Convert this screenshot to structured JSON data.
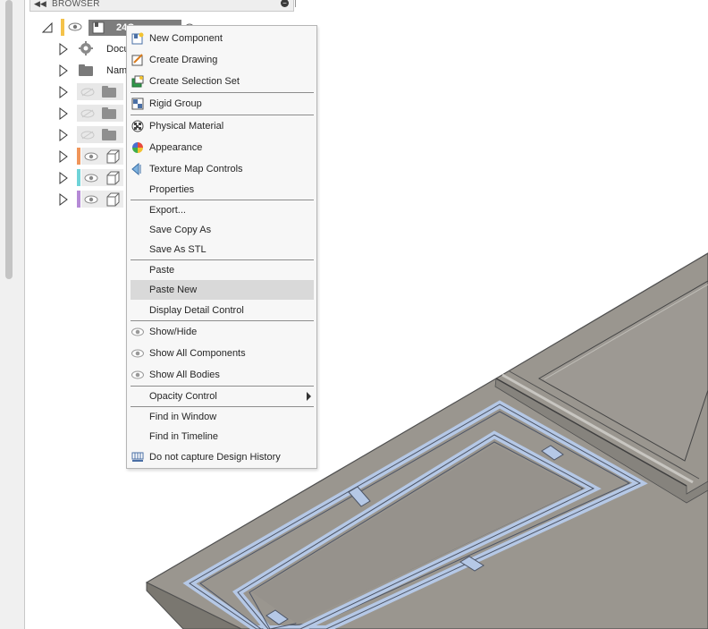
{
  "browser": {
    "title": "BROWSER",
    "collapse_icon": "double-left-arrow-icon",
    "component_label": "24C...",
    "rows": [
      {
        "label": "Docu"
      },
      {
        "label": "Nam"
      }
    ]
  },
  "context_menu": {
    "items": [
      {
        "label": "New Component",
        "icon": "new-component-icon"
      },
      {
        "label": "Create Drawing",
        "icon": "create-drawing-icon"
      },
      {
        "label": "Create Selection Set",
        "icon": "selection-set-icon"
      },
      {
        "label": "Rigid Group",
        "icon": "rigid-group-icon"
      },
      {
        "label": "Physical Material",
        "icon": "physical-material-icon"
      },
      {
        "label": "Appearance",
        "icon": "appearance-icon"
      },
      {
        "label": "Texture Map Controls",
        "icon": "texture-map-icon"
      },
      {
        "label": "Properties"
      },
      {
        "label": "Export..."
      },
      {
        "label": "Save Copy As"
      },
      {
        "label": "Save As STL"
      },
      {
        "label": "Paste"
      },
      {
        "label": "Paste New"
      },
      {
        "label": "Display Detail Control"
      },
      {
        "label": "Show/Hide",
        "icon": "eye-icon"
      },
      {
        "label": "Show All Components",
        "icon": "eye-icon"
      },
      {
        "label": "Show All Bodies",
        "icon": "eye-icon"
      },
      {
        "label": "Opacity Control",
        "submenu": true
      },
      {
        "label": "Find in Window"
      },
      {
        "label": "Find in Timeline"
      },
      {
        "label": "Do not capture Design History",
        "icon": "design-history-icon"
      }
    ]
  },
  "colors": {
    "body_orange": "#f0955a",
    "body_cyan": "#6fd3d8",
    "body_purple": "#b58ad6",
    "component_yellow": "#f4c24a",
    "model_top": "#9b9791",
    "model_edge": "#545450",
    "model_highlight": "#b4c8e6",
    "menu_highlight": "#d9d9d9"
  }
}
